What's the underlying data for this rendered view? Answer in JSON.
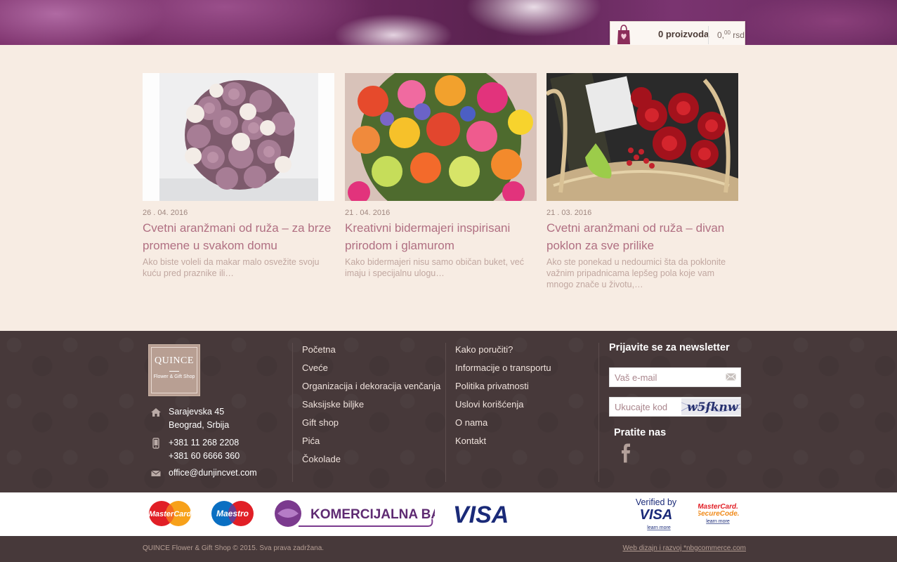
{
  "cart": {
    "count_label": "0 proizvoda",
    "total_main": "0,",
    "total_decimals": "00",
    "currency": "rsd"
  },
  "posts": [
    {
      "date": "26 . 04. 2016",
      "title": "Cvetni aranžmani od ruža – za brze promene u svakom domu",
      "excerpt": "Ako biste voleli da makar malo osvežite svoju kuću pred praznike ili…"
    },
    {
      "date": "21 . 04. 2016",
      "title": "Kreativni bidermajeri inspirisani prirodom i glamurom",
      "excerpt": "Kako bidermajeri nisu samo običan buket, već imaju i specijalnu ulogu…"
    },
    {
      "date": "21 . 03. 2016",
      "title": "Cvetni aranžmani od ruža – divan poklon za sve prilike",
      "excerpt": "Ako ste ponekad u nedoumici šta da poklonite važnim pripadnicama lepšeg pola koje vam mnogo znače u životu,…"
    }
  ],
  "logo": {
    "name": "QUINCE",
    "subtitle": "Flower & Gift Shop"
  },
  "contact": {
    "address_line1": "Sarajevska 45",
    "address_line2": "Beograd, Srbija",
    "phone1": "+381 11 268 2208",
    "phone2": "+381 60 6666 360",
    "email": "office@dunjincvet.com"
  },
  "nav_col1": [
    "Početna",
    "Cveće",
    "Organizacija i dekoracija venčanja",
    "Saksijske biljke",
    "Gift shop",
    "Pića",
    "Čokolade"
  ],
  "nav_col2": [
    "Kako poručiti?",
    "Informacije o transportu",
    "Politika privatnosti",
    "Uslovi korišćenja",
    "O nama",
    "Kontakt"
  ],
  "newsletter": {
    "title": "Prijavite se za newsletter",
    "email_placeholder": "Vaš e-mail",
    "code_placeholder": "Ukucajte kod",
    "captcha_text": "w5fknw",
    "follow_title": "Pratite nas"
  },
  "payments": {
    "mastercard": "MasterCard",
    "maestro": "Maestro",
    "bank": "KOMERCIJALNA BANKA",
    "visa": "VISA",
    "verified_by": "Verified by",
    "verified_visa": "VISA",
    "learn_more": "learn more",
    "securecode_line1": "MasterCard.",
    "securecode_line2": "SecureCode.",
    "learn_more2": "learn more"
  },
  "footer_bottom": {
    "copyright": "QUINCE Flower & Gift Shop © 2015. Sva prava zadržana.",
    "credit": "Web dizajn i razvoj *nbgcommerce.com"
  },
  "colors": {
    "accent": "#b06f82",
    "footer_bg": "#47393a",
    "page_bg": "#f7ece3"
  }
}
